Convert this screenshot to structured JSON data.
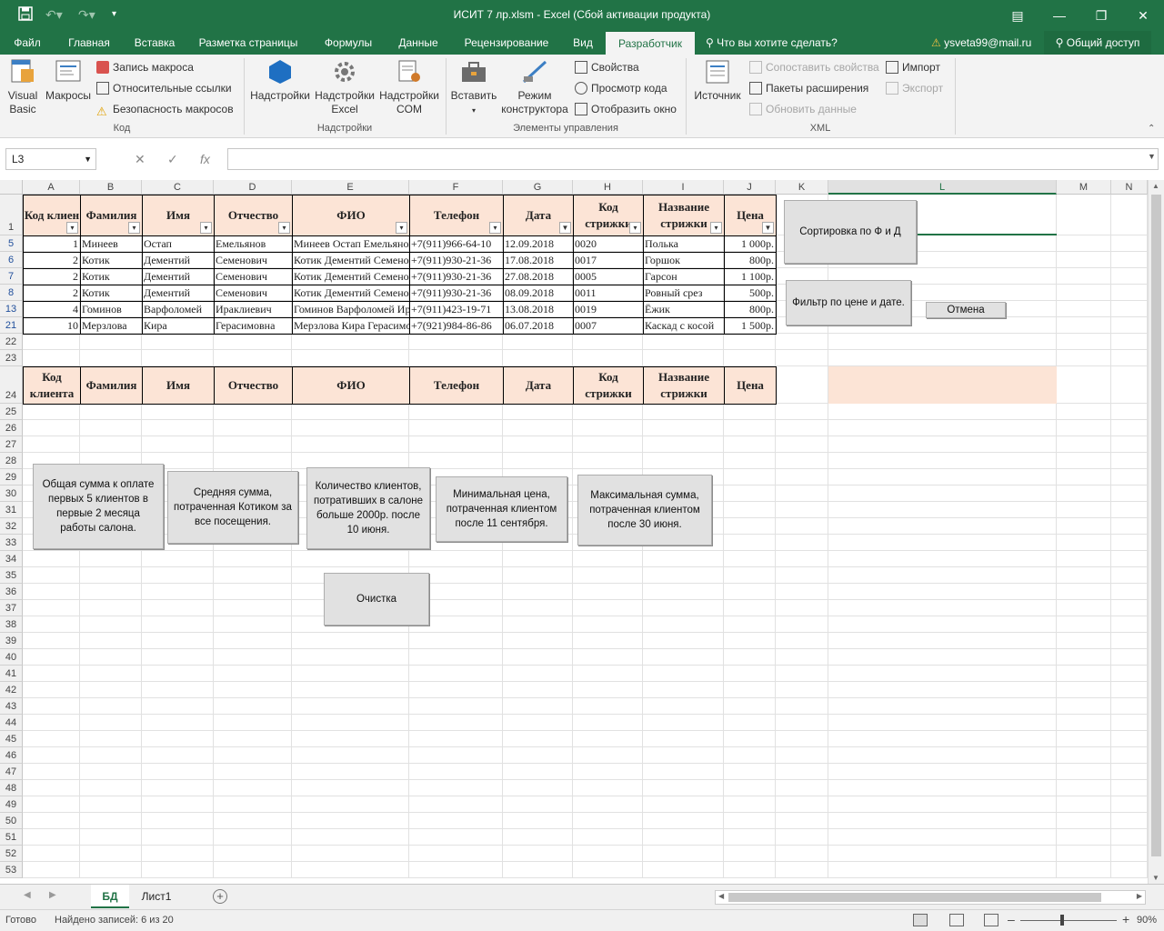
{
  "titlebar": {
    "title": "ИСИТ 7 лр.xlsm - Excel (Сбой активации продукта)",
    "save_icon": "save-icon",
    "undo_icon": "undo-icon",
    "redo_icon": "redo-icon"
  },
  "tabs": [
    {
      "label": "Файл"
    },
    {
      "label": "Главная"
    },
    {
      "label": "Вставка"
    },
    {
      "label": "Разметка страницы"
    },
    {
      "label": "Формулы"
    },
    {
      "label": "Данные"
    },
    {
      "label": "Рецензирование"
    },
    {
      "label": "Вид"
    },
    {
      "label": "Разработчик"
    }
  ],
  "tellme": "Что вы хотите сделать?",
  "user": "ysveta99@mail.ru",
  "share": "Общий доступ",
  "ribbon": {
    "code": {
      "vb_l1": "Visual",
      "vb_l2": "Basic",
      "macros": "Макросы",
      "record": "Запись макроса",
      "relative": "Относительные ссылки",
      "security": "Безопасность макросов",
      "group": "Код"
    },
    "addins": {
      "addins": "Надстройки",
      "excel_l1": "Надстройки",
      "excel_l2": "Excel",
      "com_l1": "Надстройки",
      "com_l2": "COM",
      "group": "Надстройки"
    },
    "controls": {
      "insert": "Вставить",
      "design_l1": "Режим",
      "design_l2": "конструктора",
      "props": "Свойства",
      "viewcode": "Просмотр кода",
      "dialog": "Отобразить окно",
      "group": "Элементы управления"
    },
    "xml": {
      "source": "Источник",
      "map": "Сопоставить свойства",
      "packs": "Пакеты расширения",
      "refresh": "Обновить данные",
      "import": "Импорт",
      "export": "Экспорт",
      "group": "XML"
    }
  },
  "namebox": "L3",
  "columns": [
    "A",
    "B",
    "C",
    "D",
    "E",
    "F",
    "G",
    "H",
    "I",
    "J",
    "K",
    "L",
    "M",
    "N"
  ],
  "rows": [
    "1",
    "5",
    "6",
    "7",
    "8",
    "13",
    "21",
    "22",
    "23",
    "24",
    "25",
    "26",
    "27",
    "28",
    "29",
    "30",
    "31",
    "32",
    "33",
    "34",
    "35",
    "36",
    "37",
    "38",
    "39",
    "40",
    "41",
    "42",
    "43",
    "44",
    "45",
    "46",
    "47",
    "48",
    "49",
    "50",
    "51",
    "52",
    "53"
  ],
  "header1": [
    "Код клиен",
    "Фамилия",
    "Имя",
    "Отчество",
    "ФИО",
    "Телефон",
    "Дата",
    "Код стрижки",
    "Название стрижки",
    "Цена"
  ],
  "header2": [
    "Код клиента",
    "Фамилия",
    "Имя",
    "Отчество",
    "ФИО",
    "Телефон",
    "Дата",
    "Код стрижки",
    "Название стрижки",
    "Цена"
  ],
  "data": [
    [
      "1",
      "Минеев",
      "Остап",
      "Емельянов",
      "Минеев Остап Емельянов",
      "+7(911)966-64-10",
      "12.09.2018",
      "0020",
      "Полька",
      "1 000р."
    ],
    [
      "2",
      "Котик",
      "Дементий",
      "Семенович",
      "Котик Дементий Семенович",
      "+7(911)930-21-36",
      "17.08.2018",
      "0017",
      "Горшок",
      "800р."
    ],
    [
      "2",
      "Котик",
      "Дементий",
      "Семенович",
      "Котик Дементий Семенович",
      "+7(911)930-21-36",
      "27.08.2018",
      "0005",
      "Гарсон",
      "1 100р."
    ],
    [
      "2",
      "Котик",
      "Дементий",
      "Семенович",
      "Котик Дементий Семенович",
      "+7(911)930-21-36",
      "08.09.2018",
      "0011",
      "Ровный срез",
      "500р."
    ],
    [
      "4",
      "Гоминов",
      "Варфоломей",
      "Ираклиевич",
      "Гоминов Варфоломей Ираклиевич",
      "+7(911)423-19-71",
      "13.08.2018",
      "0019",
      "Ёжик",
      "800р."
    ],
    [
      "10",
      "Мерзлова",
      "Кира",
      "Герасимовна",
      "Мерзлова Кира Герасимовна",
      "+7(921)984-86-86",
      "06.07.2018",
      "0007",
      "Каскад с косой",
      "1 500р."
    ]
  ],
  "buttons": {
    "sort": "Сортировка по Ф и Д",
    "filter": "Фильтр по цене и дате.",
    "cancel": "Отмена",
    "sum5": "Общая сумма к оплате первых 5 клиентов в первые 2 месяца работы салона.",
    "avgkotik": "Средняя сумма, потраченная Котиком за все посещения.",
    "count2000": "Количество клиентов, потративших в салоне больше 2000р. после 10 июня.",
    "minprice": "Минимальная цена, потраченная клиентом после 11 сентября.",
    "maxsum": "Максимальная сумма, потраченная клиентом после 30 июня.",
    "clear": "Очистка"
  },
  "sheets": [
    {
      "label": "БД"
    },
    {
      "label": "Лист1"
    }
  ],
  "status": {
    "ready": "Готово",
    "found": "Найдено записей: 6 из 20",
    "zoom": "90%"
  },
  "colors": {
    "accent": "#217346",
    "header_fill": "#fce4d6"
  }
}
